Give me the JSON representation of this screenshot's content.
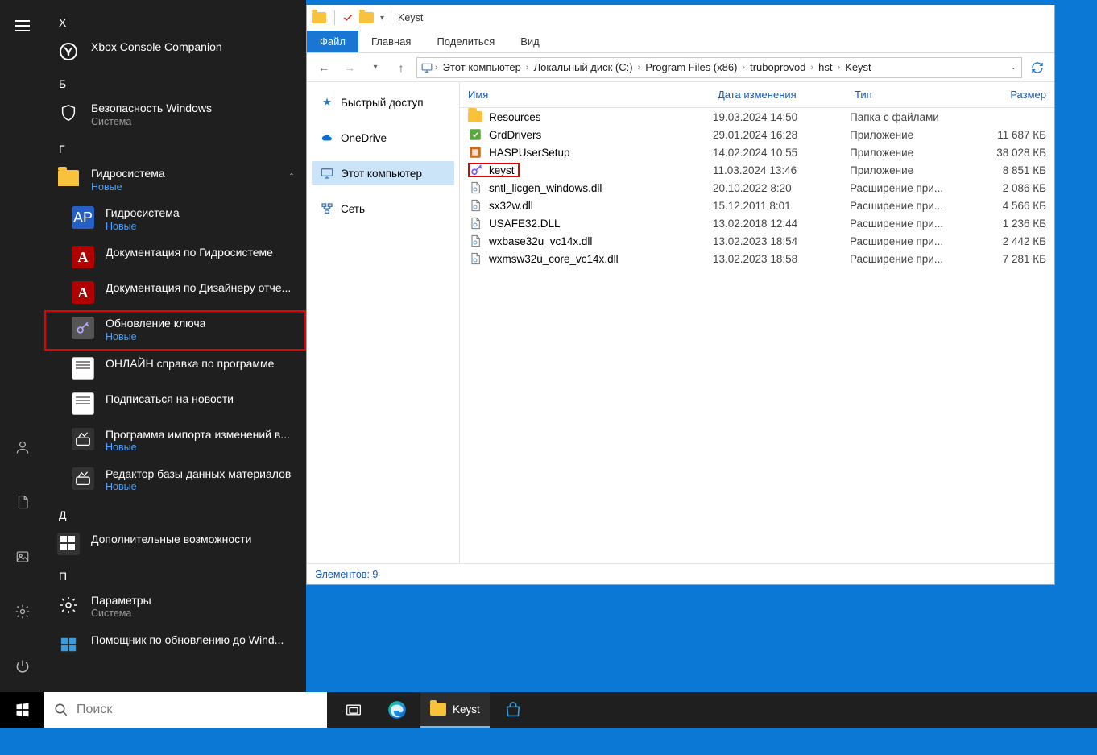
{
  "start_menu": {
    "letters": {
      "x": "X",
      "b": "Б",
      "g": "Г",
      "d": "Д",
      "p": "П"
    },
    "xbox": "Xbox Console Companion",
    "security": {
      "name": "Безопасность Windows",
      "sub": "Система"
    },
    "hydro_folder": {
      "name": "Гидросистема",
      "sub": "Новые"
    },
    "hydro_app": {
      "name": "Гидросистема",
      "sub": "Новые"
    },
    "doc_hydro": "Документация по Гидросистеме",
    "doc_designer": "Документация по Дизайнеру отче...",
    "update_key": {
      "name": "Обновление ключа",
      "sub": "Новые"
    },
    "online_help": "ОНЛАЙН справка по программе",
    "subscribe": "Подписаться на новости",
    "importer": {
      "name": "Программа импорта изменений в...",
      "sub": "Новые"
    },
    "db_editor": {
      "name": "Редактор базы данных материалов",
      "sub": "Новые"
    },
    "extras": "Дополнительные возможности",
    "settings": {
      "name": "Параметры",
      "sub": "Система"
    },
    "update_asst": "Помощник по обновлению до Wind..."
  },
  "search_placeholder": "Поиск",
  "explorer": {
    "window_title": "Keyst",
    "tabs": {
      "file": "Файл",
      "home": "Главная",
      "share": "Поделиться",
      "view": "Вид"
    },
    "breadcrumb": [
      "Этот компьютер",
      "Локальный диск (C:)",
      "Program Files (x86)",
      "truboprovod",
      "hst",
      "Keyst"
    ],
    "columns": {
      "name": "Имя",
      "date": "Дата изменения",
      "type": "Тип",
      "size": "Размер"
    },
    "tree": {
      "quick": "Быстрый доступ",
      "onedrive": "OneDrive",
      "thispc": "Этот компьютер",
      "network": "Сеть"
    },
    "files": [
      {
        "name": "Resources",
        "date": "19.03.2024 14:50",
        "type": "Папка с файлами",
        "size": "",
        "icon": "folder"
      },
      {
        "name": "GrdDrivers",
        "date": "29.01.2024 16:28",
        "type": "Приложение",
        "size": "11 687 КБ",
        "icon": "app1"
      },
      {
        "name": "HASPUserSetup",
        "date": "14.02.2024 10:55",
        "type": "Приложение",
        "size": "38 028 КБ",
        "icon": "app2"
      },
      {
        "name": "keyst",
        "date": "11.03.2024 13:46",
        "type": "Приложение",
        "size": "8 851 КБ",
        "icon": "key",
        "hl": true
      },
      {
        "name": "sntl_licgen_windows.dll",
        "date": "20.10.2022 8:20",
        "type": "Расширение при...",
        "size": "2 086 КБ",
        "icon": "dll"
      },
      {
        "name": "sx32w.dll",
        "date": "15.12.2011 8:01",
        "type": "Расширение при...",
        "size": "4 566 КБ",
        "icon": "dll"
      },
      {
        "name": "USAFE32.DLL",
        "date": "13.02.2018 12:44",
        "type": "Расширение при...",
        "size": "1 236 КБ",
        "icon": "dll"
      },
      {
        "name": "wxbase32u_vc14x.dll",
        "date": "13.02.2023 18:54",
        "type": "Расширение при...",
        "size": "2 442 КБ",
        "icon": "dll"
      },
      {
        "name": "wxmsw32u_core_vc14x.dll",
        "date": "13.02.2023 18:58",
        "type": "Расширение при...",
        "size": "7 281 КБ",
        "icon": "dll"
      }
    ],
    "status_count_label": "Элементов:",
    "status_count": "9"
  },
  "taskbar": {
    "keyst": "Keyst"
  }
}
